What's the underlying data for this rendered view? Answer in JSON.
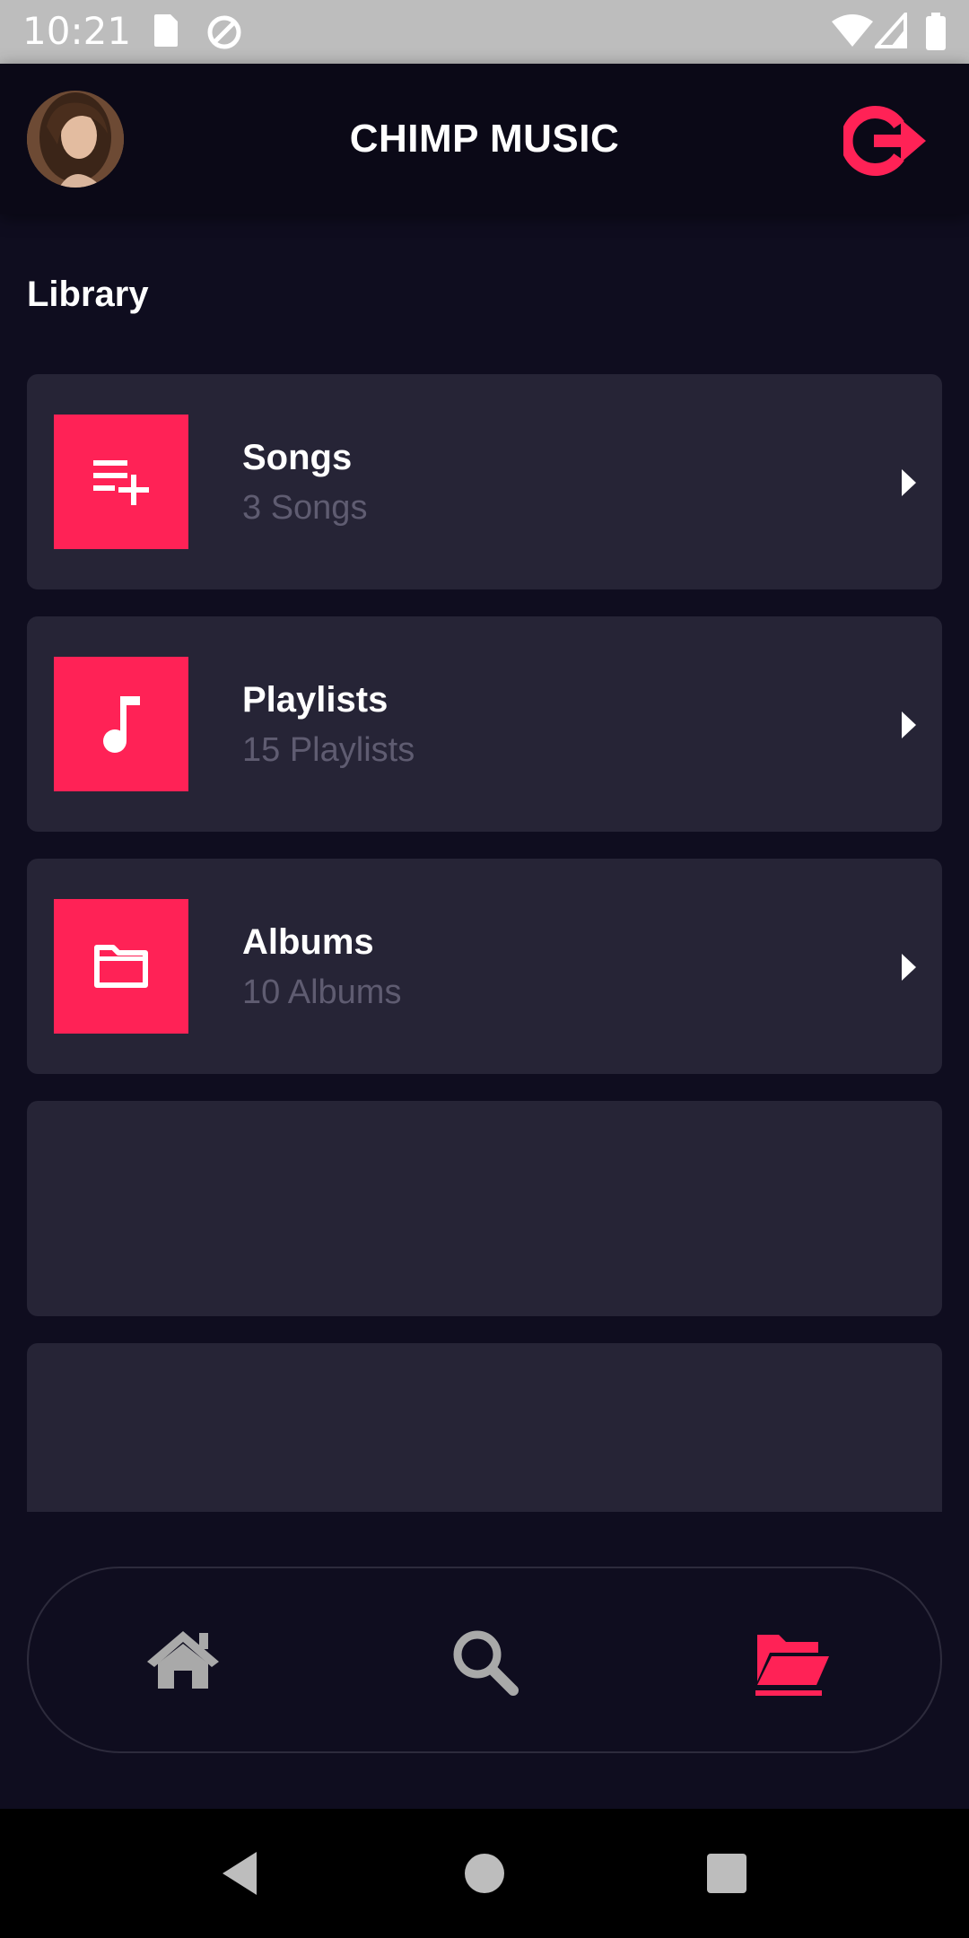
{
  "status_bar": {
    "time": "10:21",
    "icons": [
      "sd-card-icon",
      "sync-icon",
      "wifi-icon",
      "signal-icon",
      "battery-icon"
    ]
  },
  "app_bar": {
    "title": "CHIMP MUSIC",
    "avatar": "profile-avatar",
    "logout_icon": "logout-icon"
  },
  "library": {
    "heading": "Library",
    "items": [
      {
        "title": "Songs",
        "subtitle": "3 Songs",
        "icon": "playlist-add-icon"
      },
      {
        "title": "Playlists",
        "subtitle": "15 Playlists",
        "icon": "music-note-icon"
      },
      {
        "title": "Albums",
        "subtitle": "10 Albums",
        "icon": "folder-icon"
      }
    ]
  },
  "bottom_nav": {
    "items": [
      {
        "name": "home",
        "icon": "home-icon",
        "active": false
      },
      {
        "name": "search",
        "icon": "search-icon",
        "active": false
      },
      {
        "name": "library",
        "icon": "folder-open-icon",
        "active": true
      }
    ]
  },
  "colors": {
    "accent": "#ff2256",
    "background": "#0f0d1f",
    "card": "#262436",
    "subtitle": "#5f5c71",
    "inactive_icon": "#a9a9a9"
  }
}
